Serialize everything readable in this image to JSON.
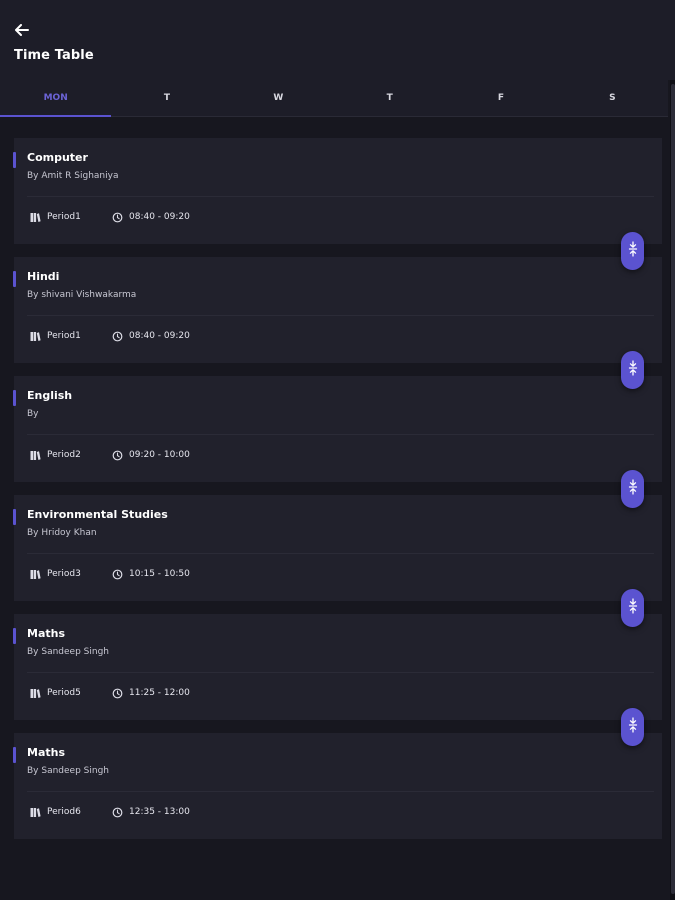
{
  "header": {
    "title": "Time Table",
    "back_icon": "arrow-left-icon"
  },
  "tabs": [
    {
      "label": "MON",
      "active": true
    },
    {
      "label": "T",
      "active": false
    },
    {
      "label": "W",
      "active": false
    },
    {
      "label": "T",
      "active": false
    },
    {
      "label": "F",
      "active": false
    },
    {
      "label": "S",
      "active": false
    }
  ],
  "colors": {
    "accent": "#5b53d0",
    "background": "#17171f",
    "card": "#21212c"
  },
  "entries": [
    {
      "subject": "Computer",
      "teacher": "By Amit R Sighaniya",
      "period": "Period1",
      "time": "08:40 - 09:20"
    },
    {
      "subject": "Hindi",
      "teacher": "By shivani Vishwakarma",
      "period": "Period1",
      "time": "08:40 - 09:20"
    },
    {
      "subject": "English",
      "teacher": "By",
      "period": "Period2",
      "time": "09:20 - 10:00"
    },
    {
      "subject": "Environmental Studies",
      "teacher": "By Hridoy Khan",
      "period": "Period3",
      "time": "10:15 - 10:50"
    },
    {
      "subject": "Maths",
      "teacher": "By Sandeep Singh",
      "period": "Period5",
      "time": "11:25 - 12:00"
    },
    {
      "subject": "Maths",
      "teacher": "By Sandeep Singh",
      "period": "Period6",
      "time": "12:35 - 13:00"
    }
  ]
}
